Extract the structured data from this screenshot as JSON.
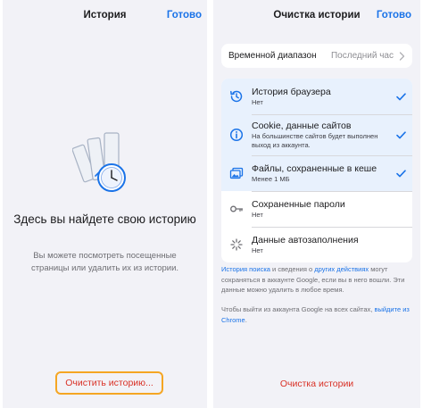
{
  "left": {
    "title": "История",
    "done": "Готово",
    "empty_title": "Здесь вы найдете свою историю",
    "empty_desc": "Вы можете посмотреть посещенные страницы или удалить их из истории.",
    "clear_button": "Очистить историю..."
  },
  "right": {
    "title": "Очистка истории",
    "done": "Готово",
    "time_range": {
      "label": "Временной диапазон",
      "value": "Последний час"
    },
    "options": [
      {
        "title": "История браузера",
        "sub": "Нет",
        "checked": true,
        "icon": "history-icon"
      },
      {
        "title": "Cookie, данные сайтов",
        "sub": "На большинстве сайтов будет выполнен выход из аккаунта.",
        "checked": true,
        "icon": "info-icon"
      },
      {
        "title": "Файлы, сохраненные в кеше",
        "sub": "Менее 1 МБ",
        "checked": true,
        "icon": "images-icon"
      },
      {
        "title": "Сохраненные пароли",
        "sub": "Нет",
        "checked": false,
        "icon": "key-icon"
      },
      {
        "title": "Данные автозаполнения",
        "sub": "Нет",
        "checked": false,
        "icon": "autofill-icon"
      }
    ],
    "note1": {
      "link1": "История поиска",
      "text1": " и сведения о ",
      "link2": "других действиях",
      "text2": " могут сохраняться в аккаунте Google, если вы в него вошли. Эти данные можно удалить в любое время."
    },
    "note2": {
      "text1": "Чтобы выйти из аккаунта Google на всех сайтах, ",
      "link": "выйдите из Chrome",
      "text2": "."
    },
    "clear_button": "Очистка истории"
  },
  "colors": {
    "accent": "#1a73e8",
    "destructive": "#d93025",
    "highlight_border": "#f5a623",
    "selected_row": "#e8f1fd"
  }
}
